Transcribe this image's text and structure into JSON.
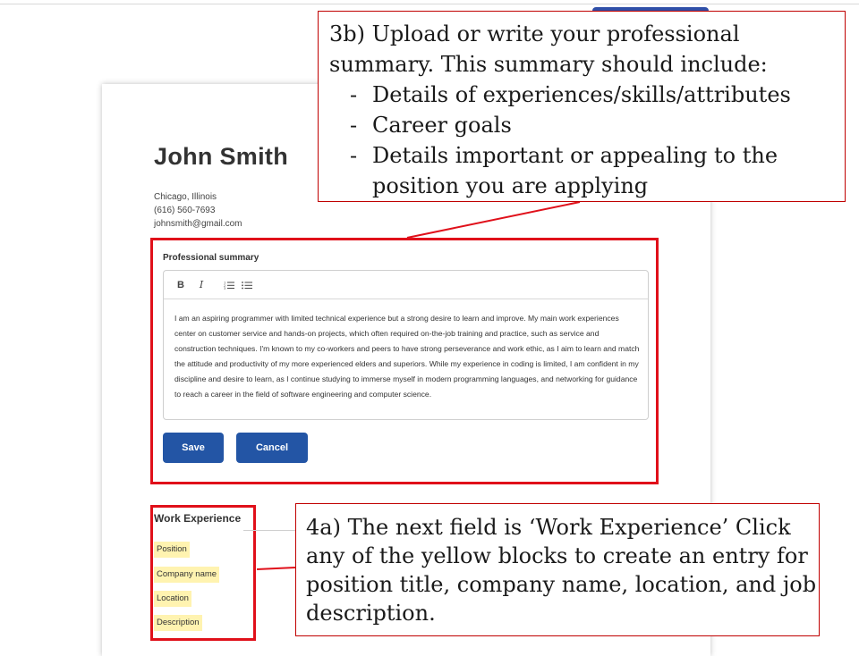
{
  "resume": {
    "name": "John Smith",
    "contact": [
      "Chicago, Illinois",
      "(616) 560-7693",
      "johnsmith@gmail.com"
    ]
  },
  "summary_section": {
    "label": "Professional summary",
    "toolbar": {
      "bold": "B",
      "italic": "I",
      "ordered_list_icon": "ordered-list-icon",
      "bullet_list_icon": "bullet-list-icon"
    },
    "text": "I am an aspiring programmer with limited technical experience but a strong desire to learn and improve. My main work experiences center on customer service and hands-on projects, which often required on-the-job training and practice, such as service and construction techniques. I'm known to my co-workers and peers to have strong perseverance and work ethic, as I aim to learn and match the attitude and productivity of my more experienced elders and superiors. While my experience in coding is limited, I am confident in my discipline and desire to learn, as I continue studying to immerse myself in modern programming languages, and networking for guidance to reach a career in the field of software engineering and computer science.",
    "save_label": "Save",
    "cancel_label": "Cancel"
  },
  "work_experience": {
    "title": "Work Experience",
    "fields": [
      "Position",
      "Company name",
      "Location",
      "Description"
    ]
  },
  "callouts": {
    "step_3b": {
      "intro": "3b) Upload or write your professional summary. This summary should include:",
      "bullets": [
        "Details of experiences/skills/attributes",
        "Career goals",
        "Details important or appealing to the position you are applying"
      ]
    },
    "step_4a": "4a) The next field is ‘Work Experience’ Click any of the yellow blocks to create an entry for position title, company name, location, and job description."
  },
  "colors": {
    "button_blue": "#2355a5",
    "highlight_red": "#e0101a",
    "chip_yellow": "#fff3b0"
  }
}
